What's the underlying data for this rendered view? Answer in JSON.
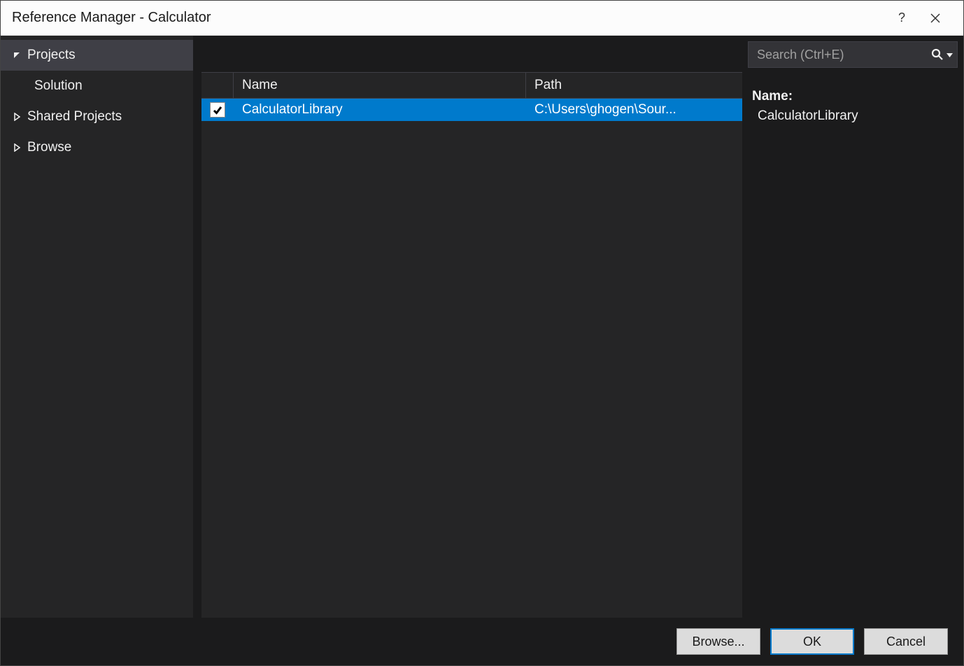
{
  "window": {
    "title": "Reference Manager - Calculator"
  },
  "sidebar": {
    "items": [
      {
        "label": "Projects",
        "expanded": true,
        "active": true
      },
      {
        "label": "Solution",
        "sub": true
      },
      {
        "label": "Shared Projects",
        "expanded": false
      },
      {
        "label": "Browse",
        "expanded": false
      }
    ]
  },
  "table": {
    "headers": {
      "name": "Name",
      "path": "Path"
    },
    "rows": [
      {
        "checked": true,
        "name": "CalculatorLibrary",
        "path": "C:\\Users\\ghogen\\Sour..."
      }
    ]
  },
  "search": {
    "placeholder": "Search (Ctrl+E)"
  },
  "details": {
    "name_label": "Name:",
    "name_value": "CalculatorLibrary"
  },
  "buttons": {
    "browse": "Browse...",
    "ok": "OK",
    "cancel": "Cancel"
  }
}
